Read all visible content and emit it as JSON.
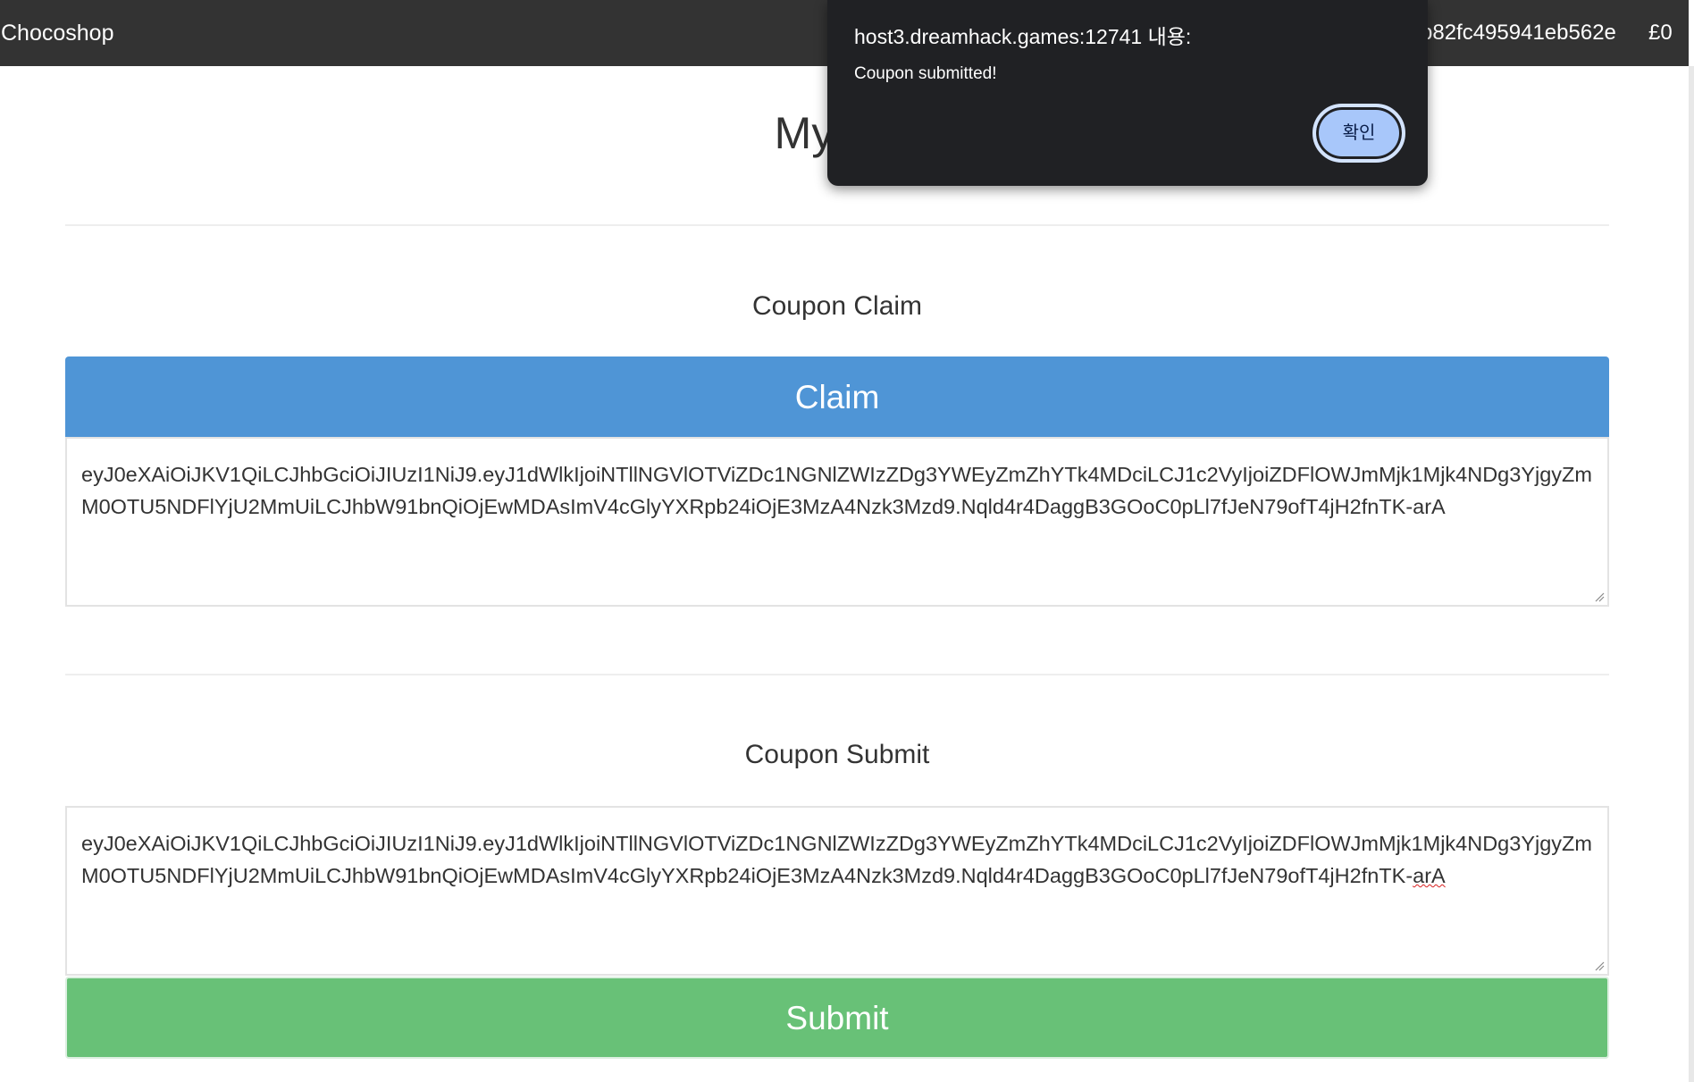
{
  "navbar": {
    "brand": "Chocoshop",
    "user_id": "b82fc495941eb562e",
    "balance": "£0"
  },
  "page": {
    "title": "My"
  },
  "claim_section": {
    "heading": "Coupon Claim",
    "button_label": "Claim",
    "token": "eyJ0eXAiOiJKV1QiLCJhbGciOiJIUzI1NiJ9.eyJ1dWlkIjoiNTllNGVlOTViZDc1NGNlZWIzZDg3YWEyZmZhYTk4MDciLCJ1c2VyIjoiZDFlOWJmMjk1Mjk4NDg3YjgyZmM0OTU5NDFlYjU2MmUiLCJhbW91bnQiOjEwMDAsImV4cGlyYXRpb24iOjE3MzA4Nzk3Mzd9.Nqld4r4DaggB3GOoC0pLl7fJeN79ofT4jH2fnTK-arA"
  },
  "submit_section": {
    "heading": "Coupon Submit",
    "token_main": "eyJ0eXAiOiJKV1QiLCJhbGciOiJIUzI1NiJ9.eyJ1dWlkIjoiNTllNGVlOTViZDc1NGNlZWIzZDg3YWEyZmZhYTk4MDciLCJ1c2VyIjoiZDFlOWJmMjk1Mjk4NDg3YjgyZmM0OTU5NDFlYjU2MmUiLCJhbW91bnQiOjEwMDAsImV4cGlyYXRpb24iOjE3MzA4Nzk3Mzd9.Nqld4r4DaggB3GOoC0pLl7fJeN79ofT4jH2fnTK-",
    "token_tail": "arA",
    "button_label": "Submit"
  },
  "alert_dialog": {
    "origin": "host3.dreamhack.games:12741 내용:",
    "message": "Coupon submitted!",
    "ok_label": "확인"
  },
  "colors": {
    "navbar": "#333333",
    "claim_button": "#4f95d6",
    "submit_button": "#68c177",
    "dialog_background": "#202124",
    "dialog_button": "#a8c7fa"
  }
}
